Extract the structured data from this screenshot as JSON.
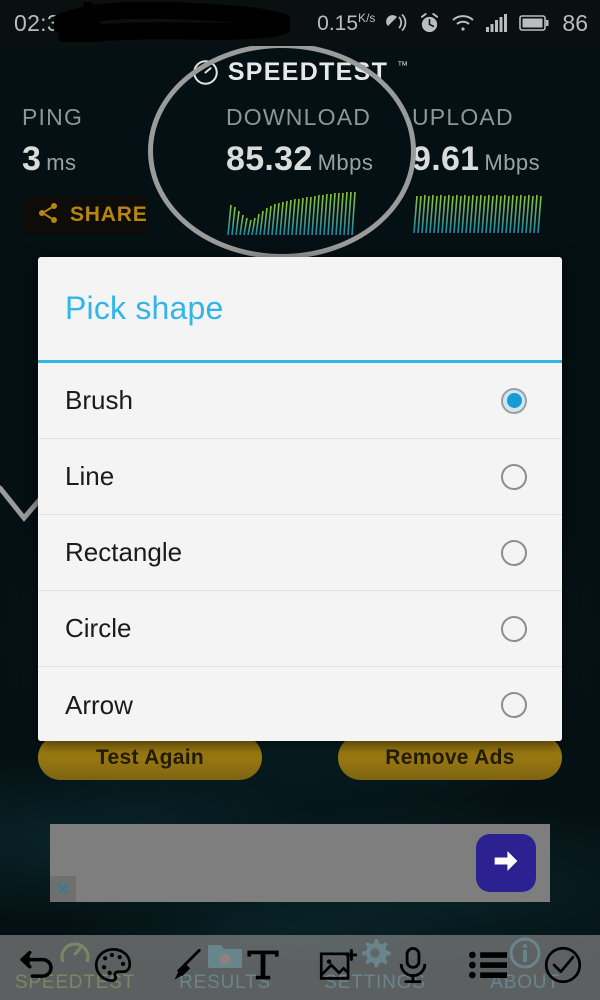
{
  "status_bar": {
    "clock": "02:36",
    "data_rate": "0.15",
    "data_rate_unit_num": "K",
    "data_rate_unit_den": "s",
    "icons": [
      "vibrate-icon",
      "alarm-icon",
      "wifi-icon",
      "signal-icon",
      "battery-icon"
    ],
    "battery_level": "86"
  },
  "speedtest": {
    "logo_text": "SPEEDTEST",
    "logo_tm": "™",
    "metrics": [
      {
        "label": "PING",
        "value": "3",
        "unit": "ms"
      },
      {
        "label": "DOWNLOAD",
        "value": "85.32",
        "unit": "Mbps"
      },
      {
        "label": "UPLOAD",
        "value": "9.61",
        "unit": "Mbps"
      }
    ],
    "share_label": "SHARE",
    "test_again_label": "Test Again",
    "remove_ads_label": "Remove Ads",
    "nav": [
      {
        "label": "SPEEDTEST",
        "icon": "gauge-icon",
        "active": true
      },
      {
        "label": "RESULTS",
        "icon": "camera-folder-icon",
        "active": false
      },
      {
        "label": "SETTINGS",
        "icon": "gear-icon",
        "active": false
      },
      {
        "label": "ABOUT",
        "icon": "info-icon",
        "active": false
      }
    ]
  },
  "ad": {
    "cta_icon": "arrow-right-icon",
    "close_label": "✕"
  },
  "dialog": {
    "title": "Pick shape",
    "title_color": "#33b5e5",
    "accent_color": "#33b5e5",
    "options": [
      {
        "label": "Brush",
        "selected": true
      },
      {
        "label": "Line",
        "selected": false
      },
      {
        "label": "Rectangle",
        "selected": false
      },
      {
        "label": "Circle",
        "selected": false
      },
      {
        "label": "Arrow",
        "selected": false
      }
    ]
  },
  "annotation_toolbar": {
    "tools": [
      {
        "name": "undo-icon"
      },
      {
        "name": "palette-icon"
      },
      {
        "name": "brush-icon"
      },
      {
        "name": "text-icon"
      },
      {
        "name": "add-image-icon"
      },
      {
        "name": "microphone-icon"
      },
      {
        "name": "list-icon"
      },
      {
        "name": "check-circle-icon"
      }
    ]
  },
  "overlay_marks": {
    "circle": "hand-drawn-circle",
    "check": "hand-drawn-check"
  }
}
